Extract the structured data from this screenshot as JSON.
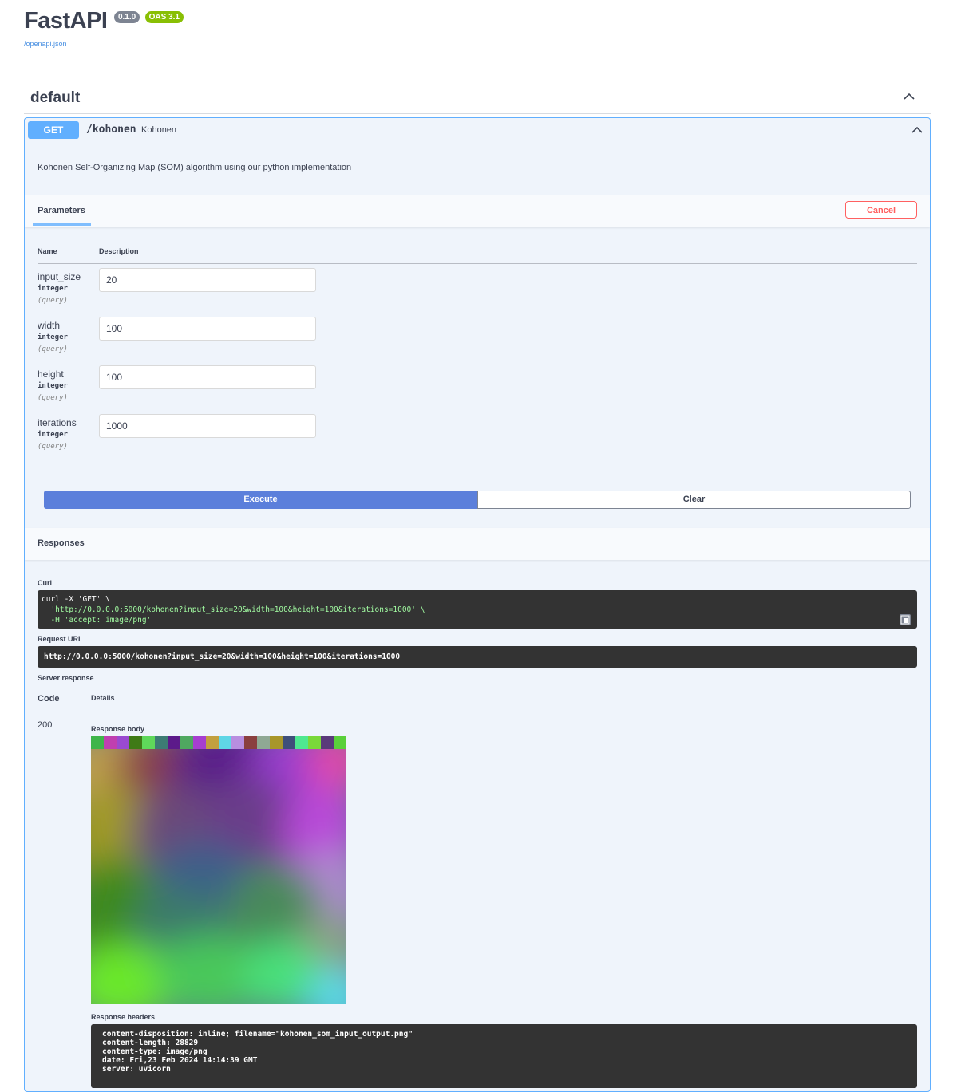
{
  "app": {
    "title": "FastAPI",
    "version_badge": "0.1.0",
    "oas_badge": "OAS 3.1",
    "spec_link": "/openapi.json"
  },
  "tag": {
    "name": "default",
    "chevron_icon": "chevron-up-icon"
  },
  "operation": {
    "method": "GET",
    "path": "/kohonen",
    "summary": "Kohonen",
    "description": "Kohonen Self-Organizing Map (SOM) algorithm using our python implementation",
    "chevron_icon": "chevron-up-icon"
  },
  "parameters_section": {
    "tab_label": "Parameters",
    "cancel_label": "Cancel",
    "col_name": "Name",
    "col_description": "Description",
    "params": [
      {
        "name": "input_size",
        "type": "integer",
        "in": "(query)",
        "value": "20"
      },
      {
        "name": "width",
        "type": "integer",
        "in": "(query)",
        "value": "100"
      },
      {
        "name": "height",
        "type": "integer",
        "in": "(query)",
        "value": "100"
      },
      {
        "name": "iterations",
        "type": "integer",
        "in": "(query)",
        "value": "1000"
      }
    ],
    "execute_label": "Execute",
    "clear_label": "Clear"
  },
  "responses_section": {
    "title": "Responses",
    "curl_label": "Curl",
    "curl_lines": [
      "curl -X 'GET' \\",
      "  'http://0.0.0.0:5000/kohonen?input_size=20&width=100&height=100&iterations=1000' \\",
      "  -H 'accept: image/png'"
    ],
    "request_url_label": "Request URL",
    "request_url": "http://0.0.0.0:5000/kohonen?input_size=20&width=100&height=100&iterations=1000",
    "server_response_label": "Server response",
    "col_code": "Code",
    "col_details": "Details",
    "status_code": "200",
    "response_body_label": "Response body",
    "response_headers_label": "Response headers",
    "response_headers": [
      "content-disposition: inline; filename=\"kohonen_som_input_output.png\"",
      "content-length: 28829",
      "content-type: image/png",
      "date: Fri,23 Feb 2024 14:14:39 GMT",
      "server: uvicorn"
    ],
    "input_color_strip": [
      "#3fb54a",
      "#c03fb0",
      "#9a4ad0",
      "#3f7a16",
      "#5fd85a",
      "#3d7c74",
      "#5c1a8a",
      "#4fa860",
      "#a63fd0",
      "#c2a03f",
      "#5fd6e6",
      "#b88ee0",
      "#8a3f3f",
      "#8fa894",
      "#a8962a",
      "#3f4f7a",
      "#4fe890",
      "#7ad83a",
      "#5a3a7a",
      "#5ad03a"
    ]
  },
  "colors": {
    "get_accent": "#61affe",
    "execute": "#5b7fdb",
    "cancel": "#ff6060",
    "code_bg": "#333333"
  }
}
